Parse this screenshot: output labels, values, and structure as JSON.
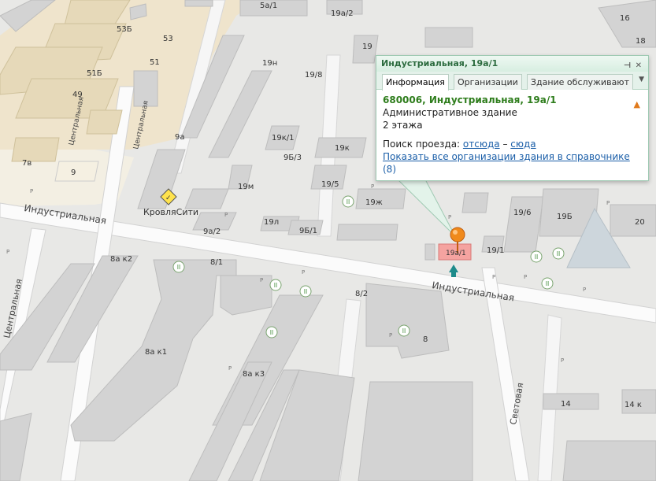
{
  "map": {
    "streets": {
      "industrialnaya_left": "Индустриальная",
      "industrialnaya_right": "Индустриальная",
      "centralnaya_a": "Центральная",
      "centralnaya_b": "Центральная",
      "centralnaya_left": "Центральная",
      "svetovaya": "Световая"
    },
    "buildings": {
      "b5a1": "5а/1",
      "b19a2": "19а/2",
      "b16": "16",
      "b18": "18",
      "b53b": "53Б",
      "b53": "53",
      "b51": "51",
      "b51b": "51Б",
      "b49": "49",
      "b19": "19",
      "b19n": "19н",
      "b19_8": "19/8",
      "b9a": "9а",
      "b7v": "7в",
      "b9": "9",
      "b19k1": "19к/1",
      "b9b3": "9Б/3",
      "b19k": "19к",
      "b19_5": "19/5",
      "b19m": "19м",
      "b19zh": "19ж",
      "b19_6": "19/6",
      "b19b": "19Б",
      "b20": "20",
      "b19l": "19л",
      "b9b1": "9Б/1",
      "b9a2": "9а/2",
      "b8ak2": "8а к2",
      "b8_1": "8/1",
      "b19a1": "19а/1",
      "b19_1": "19/1",
      "b8_2": "8/2",
      "b8": "8",
      "b8ak1": "8а к1",
      "b8ak3": "8а к3",
      "b14": "14",
      "b14k": "14 к"
    },
    "poi_label": "КровляСити",
    "parking": "Р",
    "accent_color": "#f08a1c",
    "selected_fill": "#f5a3a0"
  },
  "popup": {
    "title": "Индустриальная, 19а/1",
    "pin_icon": "pin-icon",
    "close_icon": "close-icon",
    "tabs": [
      "Информация",
      "Организации",
      "Здание обслуживают"
    ],
    "address": "680006, Индустриальная, 19а/1",
    "type": "Административное здание",
    "floors": "2 этажа",
    "route_label": "Поиск проезда:",
    "route_from": "отсюда",
    "route_dash": "–",
    "route_to": "сюда",
    "show_all": "Показать все организации здания в справочнике",
    "count": "(8)"
  }
}
